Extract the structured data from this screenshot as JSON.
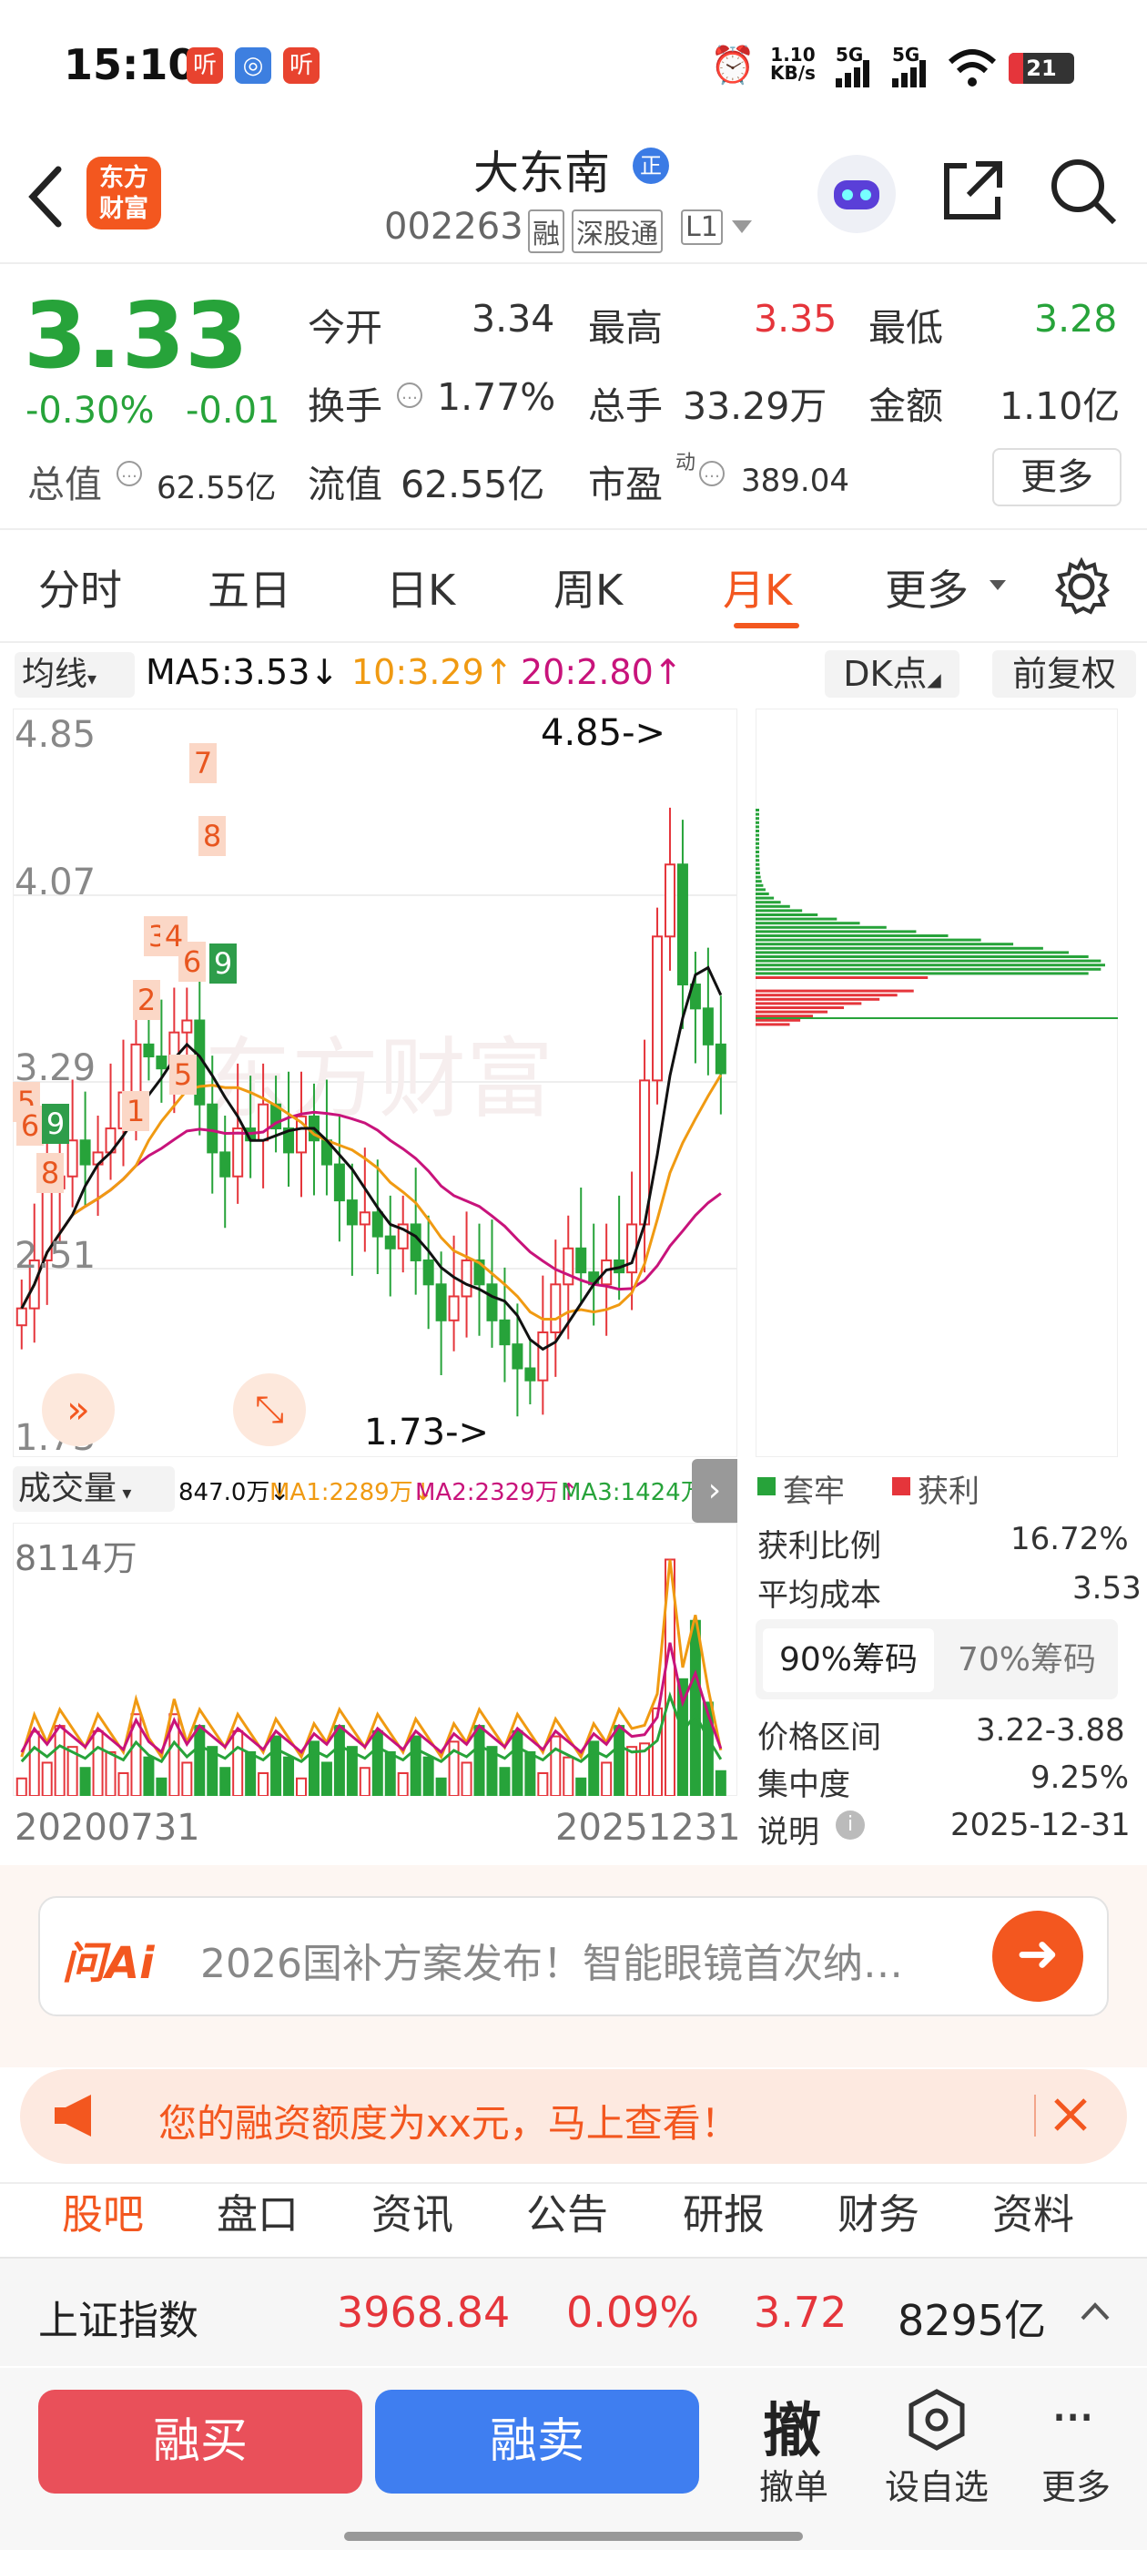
{
  "status_bar": {
    "time": "15:10",
    "app_badge": "听",
    "net_speed_top": "1.10",
    "net_speed_unit": "KB/s",
    "sim1": "5G",
    "sim2": "5G",
    "battery": "21"
  },
  "header": {
    "back_icon": "chevron-left-icon",
    "logo_text_1": "东方",
    "logo_text_2": "财富",
    "stock_name": "大东南",
    "name_badge": "正",
    "stock_code": "002263",
    "tag_margin": "融",
    "tag_connect": "深股通",
    "tag_level": "L1"
  },
  "quote": {
    "price": "3.33",
    "change_pct": "-0.30%",
    "change_amt": "-0.01",
    "open_label": "今开",
    "open": "3.34",
    "high_label": "最高",
    "high": "3.35",
    "low_label": "最低",
    "low": "3.28",
    "turnover_label": "换手",
    "turnover": "1.77%",
    "volume_label": "总手",
    "volume": "33.29万",
    "amount_label": "金额",
    "amount": "1.10亿",
    "mcap_label": "总值",
    "mcap": "62.55亿",
    "float_label": "流值",
    "float_cap": "62.55亿",
    "pe_label": "市盈",
    "pe_sup": "动",
    "pe": "389.04",
    "more_label": "更多"
  },
  "tabs": [
    "分时",
    "五日",
    "日K",
    "周K",
    "月K",
    "更多"
  ],
  "active_tab": "月K",
  "chart": {
    "ma_selector": "均线",
    "ma5": "MA5:3.53↓",
    "ma10": "10:3.29↑",
    "ma20": "20:2.80↑",
    "dk_button": "DK点",
    "fq_button": "前复权",
    "y_ticks": [
      "4.85",
      "4.07",
      "3.29",
      "2.51",
      "1.73"
    ],
    "max_label": "4.85->",
    "min_label": "1.73->",
    "markers": [
      "7",
      "8",
      "3",
      "4",
      "6",
      "9",
      "2",
      "5",
      "1",
      "5",
      "6",
      "9",
      "8"
    ],
    "watermark": "东方财富",
    "vol_selector": "成交量",
    "vol_value": "847.0万↓",
    "vol_ma1": "MA1:2289万↓",
    "vol_ma2": "MA2:2329万↑",
    "vol_ma3": "MA3:1424万↑",
    "vol_max": "8114万",
    "date_start": "20200731",
    "date_end": "20251231"
  },
  "chart_data": {
    "type": "candlestick",
    "y_range": [
      1.73,
      4.85
    ],
    "closes": [
      2.35,
      2.55,
      2.85,
      2.9,
      3.05,
      2.95,
      3.0,
      3.1,
      3.25,
      3.45,
      3.4,
      3.35,
      3.5,
      3.55,
      3.2,
      3.0,
      2.9,
      3.1,
      3.05,
      3.2,
      3.1,
      3.0,
      3.15,
      3.05,
      2.95,
      2.8,
      2.7,
      2.75,
      2.65,
      2.6,
      2.7,
      2.55,
      2.45,
      2.3,
      2.4,
      2.55,
      2.45,
      2.3,
      2.2,
      2.1,
      2.05,
      2.25,
      2.45,
      2.6,
      2.5,
      2.45,
      2.55,
      2.5,
      2.7,
      3.3,
      3.9,
      4.2,
      3.7,
      3.6,
      3.45,
      3.33
    ]
  },
  "chip": {
    "legend_trapped": "套牢",
    "legend_profit": "获利",
    "profit_ratio_label": "获利比例",
    "profit_ratio": "16.72%",
    "avg_cost_label": "平均成本",
    "avg_cost": "3.53",
    "tab90": "90%筹码",
    "tab70": "70%筹码",
    "range_label": "价格区间",
    "range": "3.22-3.88",
    "conc_label": "集中度",
    "conc": "9.25%",
    "note_label": "说明",
    "note_date": "2025-12-31"
  },
  "ai": {
    "logo": "问Ai",
    "text": "2026国补方案发布！智能眼镜首次纳…"
  },
  "banner": {
    "text": "您的融资额度为xx元，马上查看！"
  },
  "bottom_tabs": [
    "股吧",
    "盘口",
    "资讯",
    "公告",
    "研报",
    "财务",
    "资料"
  ],
  "index": {
    "name": "上证指数",
    "value": "3968.84",
    "pct": "0.09%",
    "chg": "3.72",
    "amount": "8295亿"
  },
  "actions": {
    "buy": "融买",
    "sell": "融卖",
    "cancel_icon": "撤",
    "cancel": "撤单",
    "watch": "设自选",
    "more": "更多"
  },
  "colors": {
    "up": "#e5353b",
    "down": "#27a33a",
    "accent": "#f3571f",
    "ma5": "#111111",
    "ma10": "#f09a12",
    "ma20": "#c8137b"
  }
}
